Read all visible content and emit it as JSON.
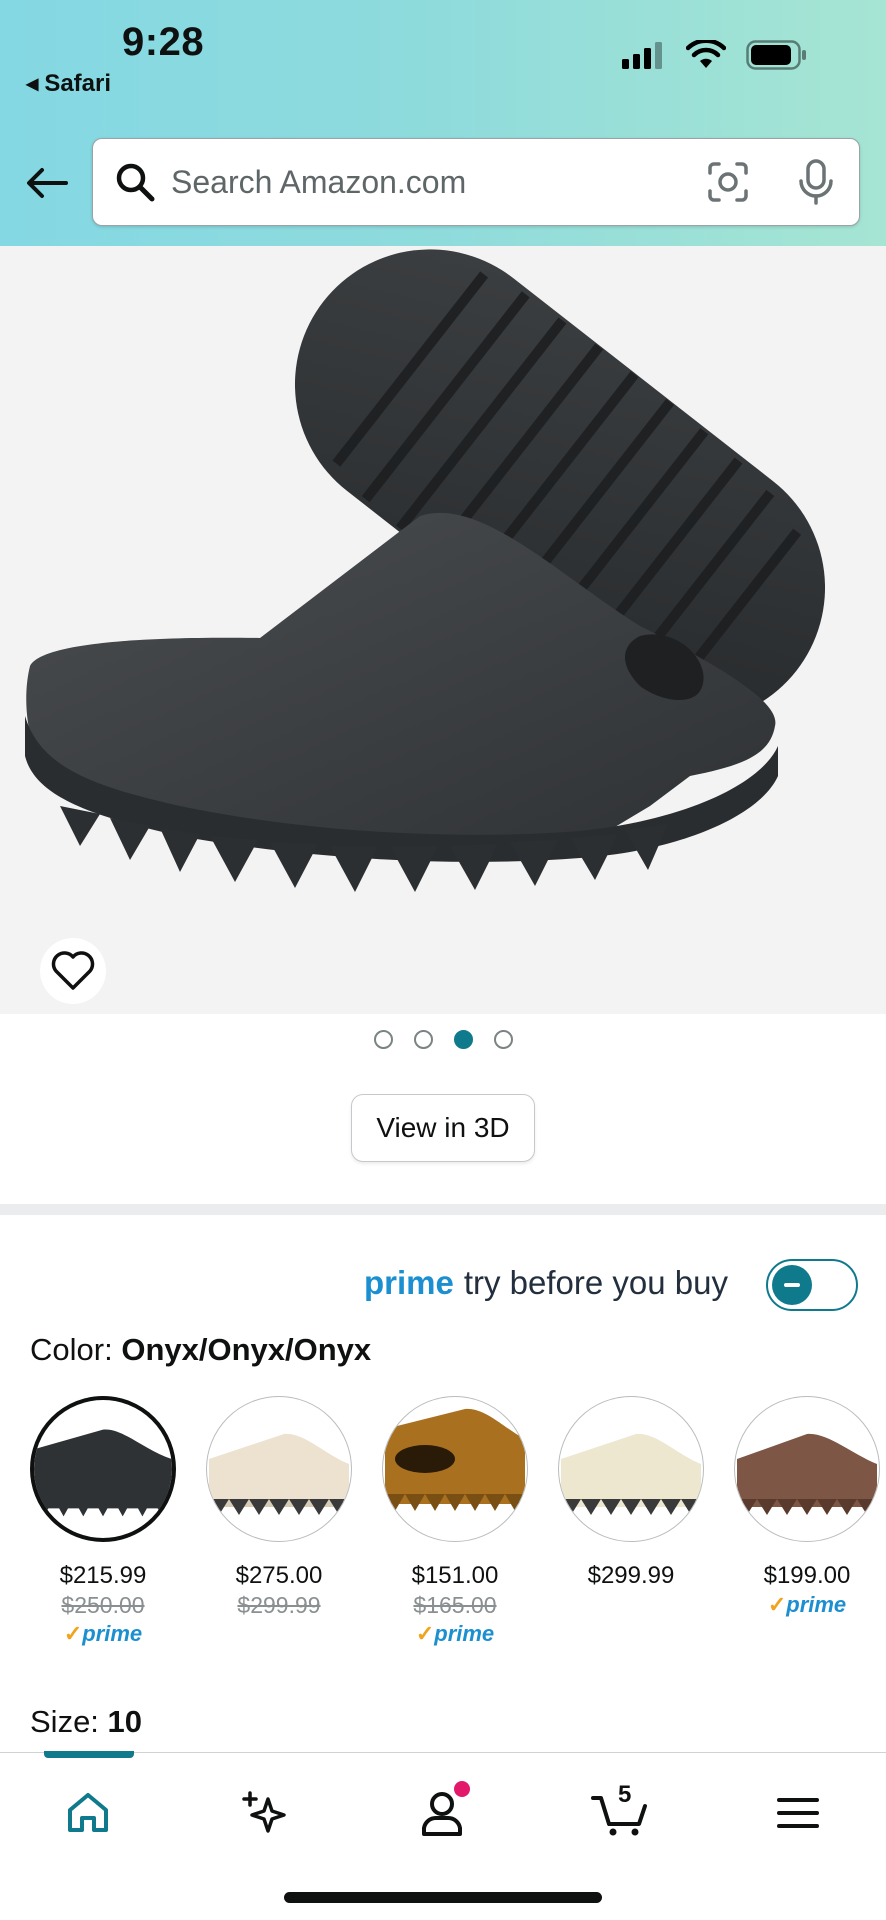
{
  "status_bar": {
    "time": "9:28",
    "back_app": "Safari"
  },
  "search": {
    "placeholder": "Search Amazon.com"
  },
  "product": {
    "gallery_page": 3,
    "gallery_total": 4,
    "view_3d_label": "View in 3D"
  },
  "prime_try": {
    "prime_word": "prime",
    "text": "try before you buy",
    "toggle_on": true
  },
  "color": {
    "label": "Color:",
    "selected": "Onyx/Onyx/Onyx"
  },
  "swatches": [
    {
      "price": "$215.99",
      "was": "$250.00",
      "prime": "prime",
      "shade": "#2f3235",
      "selected": true
    },
    {
      "price": "$275.00",
      "was": "$299.99",
      "prime": "",
      "shade": "#ece2cf",
      "selected": false
    },
    {
      "price": "$151.00",
      "was": "$165.00",
      "prime": "prime",
      "shade": "#a8701f",
      "selected": false
    },
    {
      "price": "$299.99",
      "was": "",
      "prime": "",
      "shade": "#ede7cf",
      "selected": false
    },
    {
      "price": "$199.00",
      "was": "",
      "prime": "prime",
      "shade": "#7e5645",
      "selected": false
    }
  ],
  "size": {
    "label": "Size:",
    "value": "10"
  },
  "bottom_nav": {
    "cart_count": "5",
    "active": "home"
  },
  "colors": {
    "accent": "#0f7a8c",
    "prime_blue": "#1c8fd0",
    "badge": "#e3186b"
  }
}
